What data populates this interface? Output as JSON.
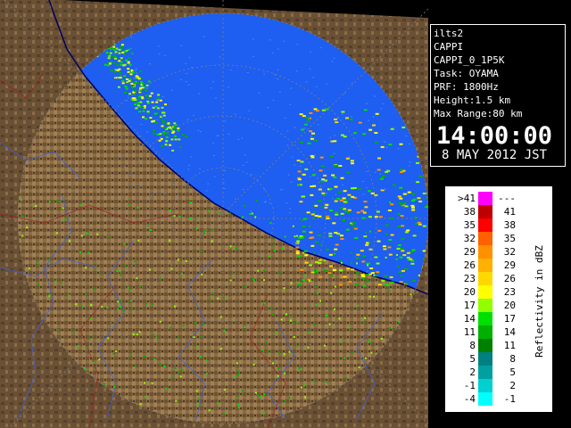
{
  "info": {
    "lines": [
      "ilts2",
      "CAPPI",
      "CAPPI_0_1P5K",
      "Task: OYAMA",
      "PRF: 1800Hz",
      "Height:1.5 km",
      "Max Range:80 km"
    ],
    "time": "14:00:00",
    "date": "8 MAY 2012 JST"
  },
  "legend": {
    "title": "Reflectivity in dBZ",
    "left_labels": [
      ">41",
      "38",
      "35",
      "32",
      "29",
      "26",
      "23",
      "20",
      "17",
      "14",
      "11",
      "8",
      "5",
      "2",
      "-1",
      "-4"
    ],
    "right_labels": [
      "---",
      "41",
      "38",
      "35",
      "32",
      "29",
      "26",
      "23",
      "20",
      "17",
      "14",
      "11",
      "8",
      "5",
      "2",
      "-1"
    ],
    "colors": [
      "#ff00ff",
      "#c00000",
      "#ff0000",
      "#ff6000",
      "#ff9000",
      "#ffb000",
      "#ffd800",
      "#ffff00",
      "#90ff00",
      "#00e000",
      "#00b000",
      "#008000",
      "#008080",
      "#00a0a0",
      "#00d0d0",
      "#00ffff"
    ]
  },
  "map": {
    "sea_color": "#1e5ef0",
    "land_color": "#8b6a40",
    "coast_color": "#000060"
  }
}
